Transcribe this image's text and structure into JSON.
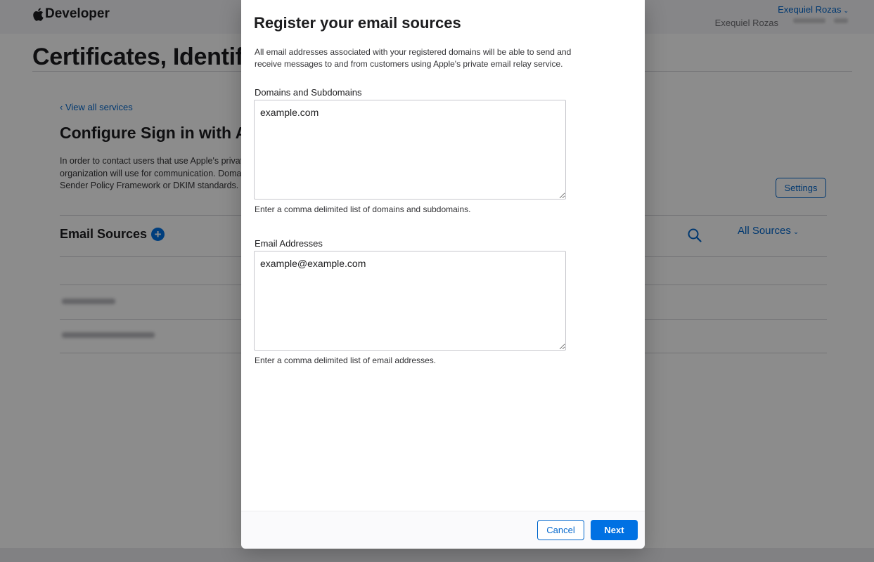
{
  "header": {
    "brand": "Developer",
    "account_name": "Exequiel Rozas",
    "team_name": "Exequiel Rozas"
  },
  "page": {
    "title": "Certificates, Identifiers & Profiles",
    "back_link": "‹ View all services",
    "section_title": "Configure Sign in with Apple for Email Communication",
    "intro_lines": [
      "In order to contact users that use Apple's private",
      "organization will use for communication. Domains",
      "Sender Policy Framework or DKIM standards."
    ],
    "settings_label": "Settings",
    "sources_heading": "Email Sources",
    "filter_label": "All Sources"
  },
  "modal": {
    "title": "Register your email sources",
    "description_lines": [
      "All email addresses associated with your registered domains will be able to send and",
      "receive messages to and from customers using Apple's private email relay service."
    ],
    "domains": {
      "label": "Domains and Subdomains",
      "value": "example.com",
      "help": "Enter a comma delimited list of domains and subdomains."
    },
    "emails": {
      "label": "Email Addresses",
      "value": "example@example.com",
      "help": "Enter a comma delimited list of email addresses."
    },
    "cancel_label": "Cancel",
    "next_label": "Next"
  },
  "colors": {
    "accent": "#0071e3",
    "link": "#0066cc",
    "overlay": "rgba(0,0,0,0.45)"
  }
}
